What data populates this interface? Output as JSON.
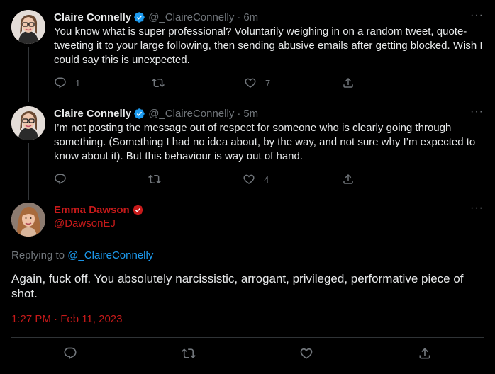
{
  "tweets": [
    {
      "name": "Claire Connelly",
      "handle": "@_ClaireConnelly",
      "separator": "·",
      "time": "6m",
      "text": "You know what is super professional? Voluntarily weighing in on a random tweet, quote-tweeting it to your large following, then sending abusive emails after getting blocked. Wish I could say this is unexpected.",
      "replies": "1",
      "retweets": "",
      "likes": "7"
    },
    {
      "name": "Claire Connelly",
      "handle": "@_ClaireConnelly",
      "separator": "·",
      "time": "5m",
      "text": "I’m not posting the message out of respect for someone who is clearly going through something. (Something I had no idea about, by the way, and not sure why I’m expected to know about it). But this behaviour is way out of hand.",
      "replies": "",
      "retweets": "",
      "likes": "4"
    }
  ],
  "main": {
    "name": "Emma Dawson",
    "handle": "@DawsonEJ",
    "replying_prefix": "Replying to",
    "replying_handle": "@_ClaireConnelly",
    "text": "Again, fuck off. You absolutely narcissistic, arrogant, privileged, performative piece of shot.",
    "timestamp": "1:27 PM · Feb 11, 2023"
  },
  "more_glyph": "···",
  "colors": {
    "background": "#000000",
    "text": "#e7e9ea",
    "muted": "#71767b",
    "link": "#1d9bf0",
    "verified_blue": "#1d9bf0",
    "verified_red": "#c71a1a",
    "highlight_red": "#c71a1a"
  },
  "icons": [
    "verified-badge-icon",
    "more-icon",
    "reply-icon",
    "retweet-icon",
    "like-icon",
    "share-icon"
  ]
}
